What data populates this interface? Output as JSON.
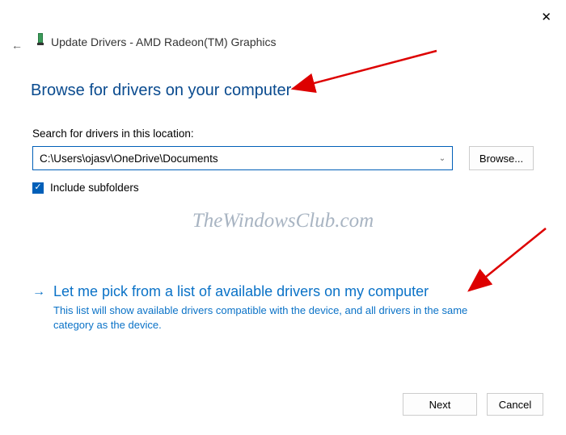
{
  "header": {
    "title": "Update Drivers - AMD Radeon(TM) Graphics"
  },
  "main": {
    "heading": "Browse for drivers on your computer",
    "search_label": "Search for drivers in this location:",
    "path_value": "C:\\Users\\ojasv\\OneDrive\\Documents",
    "browse_label": "Browse...",
    "include_subfolders_label": "Include subfolders",
    "include_subfolders_checked": true
  },
  "pick": {
    "title": "Let me pick from a list of available drivers on my computer",
    "description": "This list will show available drivers compatible with the device, and all drivers in the same category as the device."
  },
  "footer": {
    "next_label": "Next",
    "cancel_label": "Cancel"
  },
  "watermark": "TheWindowsClub.com"
}
